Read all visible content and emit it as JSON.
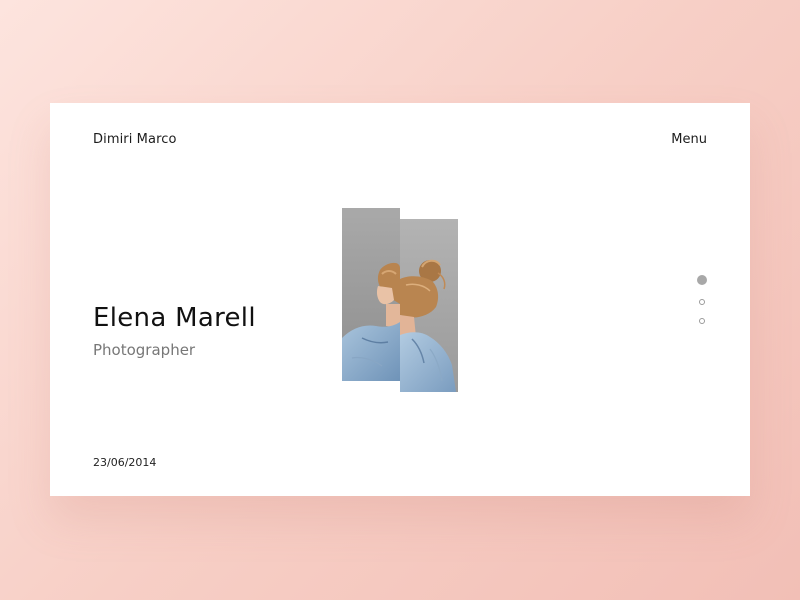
{
  "header": {
    "brand": "Dimiri Marco",
    "menu_label": "Menu"
  },
  "hero": {
    "name": "Elena Marell",
    "role": "Photographer",
    "date": "23/06/2014"
  },
  "slider": {
    "total": 3,
    "active_index": 0
  },
  "colors": {
    "background_light": "#fde4de",
    "background_dark": "#f2bfb6",
    "card": "#ffffff",
    "text_primary": "#111111",
    "text_secondary": "#777777"
  }
}
